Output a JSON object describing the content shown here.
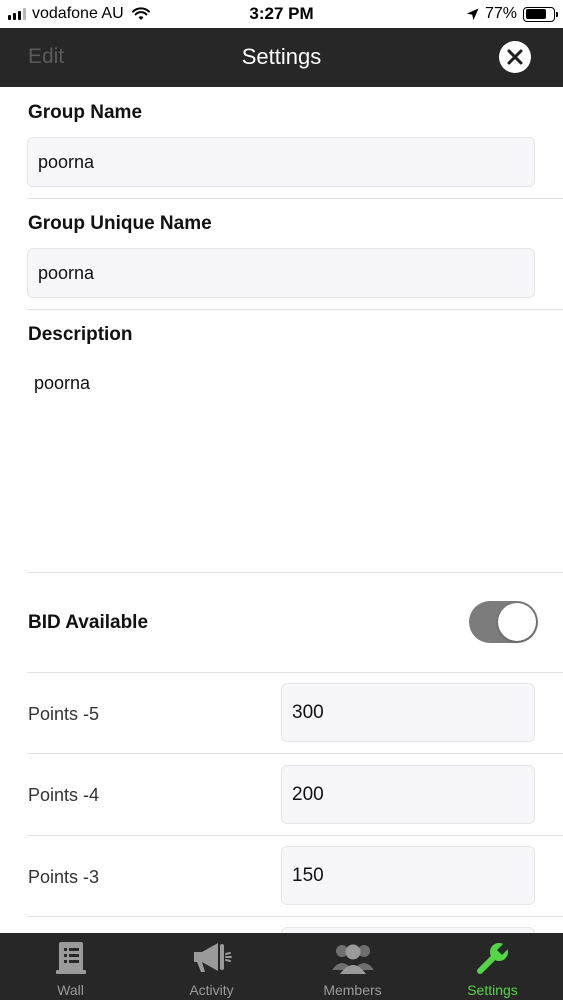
{
  "status_bar": {
    "carrier": "vodafone AU",
    "time": "3:27 PM",
    "battery": "77%",
    "battery_level": 0.77
  },
  "nav": {
    "edit_label": "Edit",
    "title": "Settings"
  },
  "form": {
    "group_name_label": "Group Name",
    "group_name_value": "poorna",
    "group_unique_name_label": "Group Unique Name",
    "group_unique_name_value": "poorna",
    "description_label": "Description",
    "description_value": "poorna",
    "bid_available_label": "BID Available",
    "bid_available_on": true
  },
  "points": [
    {
      "label": "Points -5",
      "value": "300"
    },
    {
      "label": "Points -4",
      "value": "200"
    },
    {
      "label": "Points -3",
      "value": "150"
    }
  ],
  "tabs": [
    {
      "label": "Wall",
      "icon": "wall-icon",
      "active": false
    },
    {
      "label": "Activity",
      "icon": "megaphone-icon",
      "active": false
    },
    {
      "label": "Members",
      "icon": "members-icon",
      "active": false
    },
    {
      "label": "Settings",
      "icon": "wrench-icon",
      "active": true
    }
  ],
  "colors": {
    "nav_background": "#272727",
    "active_tab": "#55d646",
    "inactive_tab": "#9a9a9a",
    "toggle_on": "#7c7c7c"
  }
}
